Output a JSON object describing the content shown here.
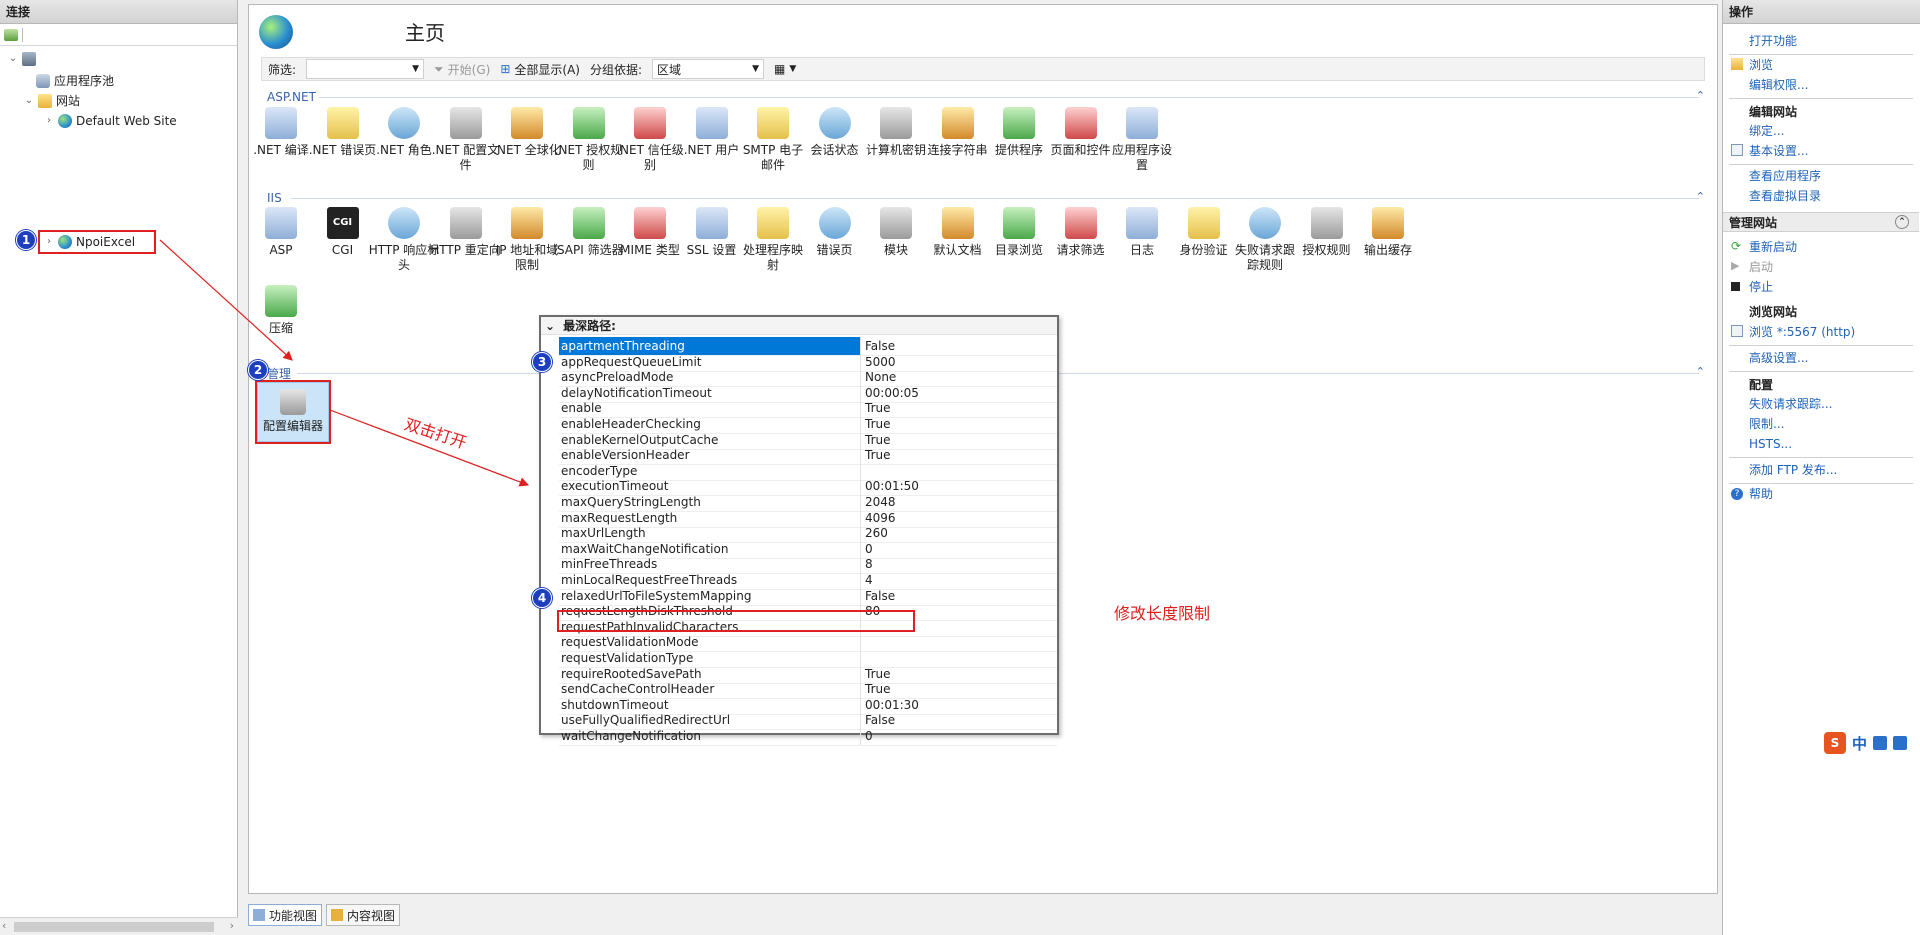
{
  "left": {
    "title": "连接",
    "tree": {
      "app_pools": "应用程序池",
      "sites": "网站",
      "default_site": "Default Web Site",
      "npoi_site": "NpoiExcel"
    }
  },
  "center": {
    "home_title": "主页",
    "filter": {
      "label": "筛选:",
      "start": "开始(G)",
      "show_all": "全部显示(A)",
      "group_by_label": "分组依据:",
      "group_by_value": "区域"
    },
    "sections": {
      "aspnet": "ASP.NET",
      "iis": "IIS",
      "management": "管理"
    },
    "aspnet_features": [
      {
        "l1": ".NET 编译",
        "l2": ""
      },
      {
        "l1": ".NET 错误页",
        "l2": ""
      },
      {
        "l1": ".NET 角色",
        "l2": ""
      },
      {
        "l1": ".NET 配置文",
        "l2": "件"
      },
      {
        "l1": ".NET 全球化",
        "l2": ""
      },
      {
        "l1": ".NET 授权规",
        "l2": "则"
      },
      {
        "l1": ".NET 信任级",
        "l2": "别"
      },
      {
        "l1": ".NET 用户",
        "l2": ""
      },
      {
        "l1": "SMTP 电子",
        "l2": "邮件"
      },
      {
        "l1": "会话状态",
        "l2": ""
      },
      {
        "l1": "计算机密钥",
        "l2": ""
      },
      {
        "l1": "连接字符串",
        "l2": ""
      },
      {
        "l1": "提供程序",
        "l2": ""
      },
      {
        "l1": "页面和控件",
        "l2": ""
      },
      {
        "l1": "应用程序设",
        "l2": "置"
      }
    ],
    "iis_features": [
      {
        "l1": "ASP",
        "l2": ""
      },
      {
        "l1": "CGI",
        "l2": ""
      },
      {
        "l1": "HTTP 响应标",
        "l2": "头"
      },
      {
        "l1": "HTTP 重定向",
        "l2": ""
      },
      {
        "l1": "IP 地址和域",
        "l2": "限制"
      },
      {
        "l1": "ISAPI 筛选器",
        "l2": ""
      },
      {
        "l1": "MIME 类型",
        "l2": ""
      },
      {
        "l1": "SSL 设置",
        "l2": ""
      },
      {
        "l1": "处理程序映",
        "l2": "射"
      },
      {
        "l1": "错误页",
        "l2": ""
      },
      {
        "l1": "模块",
        "l2": ""
      },
      {
        "l1": "默认文档",
        "l2": ""
      },
      {
        "l1": "目录浏览",
        "l2": ""
      },
      {
        "l1": "请求筛选",
        "l2": ""
      },
      {
        "l1": "日志",
        "l2": ""
      },
      {
        "l1": "身份验证",
        "l2": ""
      },
      {
        "l1": "失败请求跟",
        "l2": "踪规则"
      },
      {
        "l1": "授权规则",
        "l2": ""
      },
      {
        "l1": "输出缓存",
        "l2": ""
      },
      {
        "l1": "压缩",
        "l2": ""
      }
    ],
    "mgmt_feature": "配置编辑器",
    "grid": {
      "header": "最深路径:",
      "rows": [
        {
          "name": "apartmentThreading",
          "value": "False"
        },
        {
          "name": "appRequestQueueLimit",
          "value": "5000"
        },
        {
          "name": "asyncPreloadMode",
          "value": "None"
        },
        {
          "name": "delayNotificationTimeout",
          "value": "00:00:05"
        },
        {
          "name": "enable",
          "value": "True"
        },
        {
          "name": "enableHeaderChecking",
          "value": "True"
        },
        {
          "name": "enableKernelOutputCache",
          "value": "True"
        },
        {
          "name": "enableVersionHeader",
          "value": "True"
        },
        {
          "name": "encoderType",
          "value": ""
        },
        {
          "name": "executionTimeout",
          "value": "00:01:50"
        },
        {
          "name": "maxQueryStringLength",
          "value": "2048"
        },
        {
          "name": "maxRequestLength",
          "value": "4096"
        },
        {
          "name": "maxUrlLength",
          "value": "260"
        },
        {
          "name": "maxWaitChangeNotification",
          "value": "0"
        },
        {
          "name": "minFreeThreads",
          "value": "8"
        },
        {
          "name": "minLocalRequestFreeThreads",
          "value": "4"
        },
        {
          "name": "relaxedUrlToFileSystemMapping",
          "value": "False"
        },
        {
          "name": "requestLengthDiskThreshold",
          "value": "80"
        },
        {
          "name": "requestPathInvalidCharacters",
          "value": ""
        },
        {
          "name": "requestValidationMode",
          "value": ""
        },
        {
          "name": "requestValidationType",
          "value": ""
        },
        {
          "name": "requireRootedSavePath",
          "value": "True"
        },
        {
          "name": "sendCacheControlHeader",
          "value": "True"
        },
        {
          "name": "shutdownTimeout",
          "value": "00:01:30"
        },
        {
          "name": "useFullyQualifiedRedirectUrl",
          "value": "False"
        },
        {
          "name": "waitChangeNotification",
          "value": "0"
        }
      ]
    },
    "annotations": {
      "b1": "1",
      "b2": "2",
      "b3": "3",
      "b4": "4",
      "double_click": "双击打开",
      "modify_limit": "修改长度限制"
    },
    "tabs": {
      "feature_view": "功能视图",
      "content_view": "内容视图"
    }
  },
  "right": {
    "title": "操作",
    "open_feature": "打开功能",
    "browse": "浏览",
    "edit_perms": "编辑权限...",
    "edit_site": "编辑网站",
    "bindings": "绑定...",
    "basic_settings": "基本设置...",
    "view_apps": "查看应用程序",
    "view_vdirs": "查看虚拟目录",
    "manage_site": "管理网站",
    "restart": "重新启动",
    "start": "启动",
    "stop": "停止",
    "browse_site": "浏览网站",
    "browse_port": "浏览 *:5567 (http)",
    "advanced": "高级设置...",
    "configure": "配置",
    "failed_req": "失败请求跟踪...",
    "limits": "限制...",
    "hsts": "HSTS...",
    "add_ftp": "添加 FTP 发布...",
    "help": "帮助"
  },
  "ime": {
    "zh": "中"
  }
}
